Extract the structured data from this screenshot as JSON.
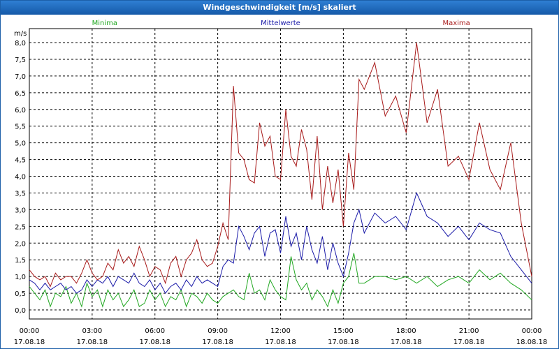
{
  "window": {
    "title": "Windgeschwindigkeit [m/s] skaliert"
  },
  "chart_data": {
    "type": "line",
    "title": "Windgeschwindigkeit [m/s] skaliert",
    "ylabel": "m/s",
    "xlabel": "",
    "ylim": [
      0,
      8
    ],
    "xlim": [
      0,
      24
    ],
    "grid": true,
    "legend_position": "top",
    "y_ticks": [
      "0,0",
      "0,5",
      "1,0",
      "1,5",
      "2,0",
      "2,5",
      "3,0",
      "3,5",
      "4,0",
      "4,5",
      "5,0",
      "5,5",
      "6,0",
      "6,5",
      "7,0",
      "7,5",
      "8,0"
    ],
    "x_ticks": [
      {
        "time": "00:00",
        "date": "17.08.18"
      },
      {
        "time": "03:00",
        "date": "17.08.18"
      },
      {
        "time": "06:00",
        "date": "17.08.18"
      },
      {
        "time": "09:00",
        "date": "17.08.18"
      },
      {
        "time": "12:00",
        "date": "17.08.18"
      },
      {
        "time": "15:00",
        "date": "17.08.18"
      },
      {
        "time": "18:00",
        "date": "17.08.18"
      },
      {
        "time": "21:00",
        "date": "17.08.18"
      },
      {
        "time": "00:00",
        "date": "18.08.18"
      }
    ],
    "series": [
      {
        "name": "Minima",
        "color": "#22a822",
        "x": [
          0,
          0.25,
          0.5,
          0.75,
          1,
          1.25,
          1.5,
          1.75,
          2,
          2.25,
          2.5,
          2.75,
          3,
          3.25,
          3.5,
          3.75,
          4,
          4.25,
          4.5,
          4.75,
          5,
          5.25,
          5.5,
          5.75,
          6,
          6.25,
          6.5,
          6.75,
          7,
          7.25,
          7.5,
          7.75,
          8,
          8.25,
          8.5,
          8.75,
          9,
          9.25,
          9.5,
          9.75,
          10,
          10.25,
          10.5,
          10.75,
          11,
          11.25,
          11.5,
          11.75,
          12,
          12.25,
          12.5,
          12.75,
          13,
          13.25,
          13.5,
          13.75,
          14,
          14.25,
          14.5,
          14.75,
          15,
          15.25,
          15.5,
          15.75,
          16,
          16.5,
          17,
          17.5,
          18,
          18.5,
          19,
          19.5,
          20,
          20.5,
          21,
          21.5,
          22,
          22.5,
          23,
          23.5,
          24
        ],
        "values": [
          0.7,
          0.5,
          0.3,
          0.6,
          0.1,
          0.5,
          0.4,
          0.7,
          0.2,
          0.5,
          0.1,
          0.8,
          0.4,
          0.6,
          0.1,
          0.6,
          0.3,
          0.5,
          0.1,
          0.3,
          0.6,
          0.1,
          0.2,
          0.6,
          0.3,
          0.5,
          0.1,
          0.4,
          0.3,
          0.6,
          0.1,
          0.5,
          0.4,
          0.2,
          0.5,
          0.3,
          0.2,
          0.4,
          0.5,
          0.6,
          0.4,
          0.3,
          1.1,
          0.5,
          0.6,
          0.3,
          0.9,
          0.6,
          0.4,
          0.3,
          1.6,
          0.9,
          0.6,
          0.8,
          0.3,
          0.6,
          0.4,
          0.1,
          0.6,
          0.2,
          0.8,
          1.0,
          1.7,
          0.8,
          0.8,
          1.0,
          1.0,
          0.9,
          1.0,
          0.8,
          1.0,
          0.7,
          0.9,
          1.0,
          0.8,
          1.2,
          0.9,
          1.1,
          0.8,
          0.6,
          0.3
        ]
      },
      {
        "name": "Mittelwerte",
        "color": "#1a1aa8",
        "x": [
          0,
          0.25,
          0.5,
          0.75,
          1,
          1.25,
          1.5,
          1.75,
          2,
          2.25,
          2.5,
          2.75,
          3,
          3.25,
          3.5,
          3.75,
          4,
          4.25,
          4.5,
          4.75,
          5,
          5.25,
          5.5,
          5.75,
          6,
          6.25,
          6.5,
          6.75,
          7,
          7.25,
          7.5,
          7.75,
          8,
          8.25,
          8.5,
          8.75,
          9,
          9.25,
          9.5,
          9.75,
          10,
          10.25,
          10.5,
          10.75,
          11,
          11.25,
          11.5,
          11.75,
          12,
          12.25,
          12.5,
          12.75,
          13,
          13.25,
          13.5,
          13.75,
          14,
          14.25,
          14.5,
          14.75,
          15,
          15.25,
          15.5,
          15.75,
          16,
          16.5,
          17,
          17.5,
          18,
          18.5,
          19,
          19.5,
          20,
          20.5,
          21,
          21.5,
          22,
          22.5,
          23,
          23.5,
          24
        ],
        "values": [
          0.9,
          0.8,
          0.6,
          0.8,
          0.6,
          0.7,
          0.8,
          0.6,
          0.7,
          0.5,
          0.6,
          0.9,
          0.7,
          0.9,
          0.8,
          1.0,
          0.7,
          1.0,
          0.9,
          0.8,
          1.1,
          0.8,
          0.7,
          0.9,
          0.6,
          0.8,
          0.5,
          0.7,
          0.8,
          0.6,
          0.9,
          0.7,
          1.0,
          0.8,
          0.9,
          0.8,
          0.7,
          1.3,
          1.5,
          1.4,
          2.5,
          2.2,
          1.8,
          2.3,
          2.5,
          1.6,
          2.3,
          2.4,
          1.7,
          2.8,
          1.9,
          2.3,
          1.5,
          2.5,
          1.8,
          1.4,
          2.2,
          1.2,
          2.0,
          1.4,
          1.0,
          1.7,
          2.6,
          3.0,
          2.3,
          2.9,
          2.6,
          2.8,
          2.4,
          3.5,
          2.8,
          2.6,
          2.2,
          2.5,
          2.1,
          2.6,
          2.4,
          2.3,
          1.6,
          1.2,
          0.8
        ]
      },
      {
        "name": "Maxima",
        "color": "#a81a1a",
        "x": [
          0,
          0.25,
          0.5,
          0.75,
          1,
          1.25,
          1.5,
          1.75,
          2,
          2.25,
          2.5,
          2.75,
          3,
          3.25,
          3.5,
          3.75,
          4,
          4.25,
          4.5,
          4.75,
          5,
          5.25,
          5.5,
          5.75,
          6,
          6.25,
          6.5,
          6.75,
          7,
          7.25,
          7.5,
          7.75,
          8,
          8.25,
          8.5,
          8.75,
          9,
          9.25,
          9.5,
          9.75,
          10,
          10.25,
          10.5,
          10.75,
          11,
          11.25,
          11.5,
          11.75,
          12,
          12.25,
          12.5,
          12.75,
          13,
          13.25,
          13.5,
          13.75,
          14,
          14.25,
          14.5,
          14.75,
          15,
          15.25,
          15.5,
          15.75,
          16,
          16.5,
          17,
          17.5,
          18,
          18.5,
          19,
          19.5,
          20,
          20.5,
          21,
          21.5,
          22,
          22.5,
          23,
          23.5,
          24
        ],
        "values": [
          1.2,
          1.0,
          0.9,
          1.0,
          0.7,
          1.1,
          0.9,
          1.0,
          1.0,
          0.8,
          1.1,
          1.5,
          1.1,
          0.9,
          1.0,
          1.4,
          1.2,
          1.8,
          1.4,
          1.6,
          1.3,
          1.9,
          1.5,
          1.0,
          1.3,
          1.2,
          0.8,
          1.4,
          1.6,
          1.0,
          1.5,
          1.7,
          2.1,
          1.5,
          1.3,
          1.4,
          1.9,
          2.6,
          2.1,
          6.7,
          4.7,
          4.5,
          3.9,
          3.8,
          5.6,
          4.9,
          5.2,
          4.0,
          3.9,
          6.0,
          4.6,
          4.3,
          5.4,
          4.8,
          3.3,
          5.2,
          3.0,
          4.3,
          3.2,
          4.2,
          2.5,
          4.7,
          3.6,
          6.9,
          6.6,
          7.4,
          5.8,
          6.4,
          5.3,
          8.0,
          5.6,
          6.6,
          4.3,
          4.6,
          3.9,
          5.6,
          4.2,
          3.6,
          5.0,
          2.6,
          1.0
        ]
      }
    ]
  }
}
